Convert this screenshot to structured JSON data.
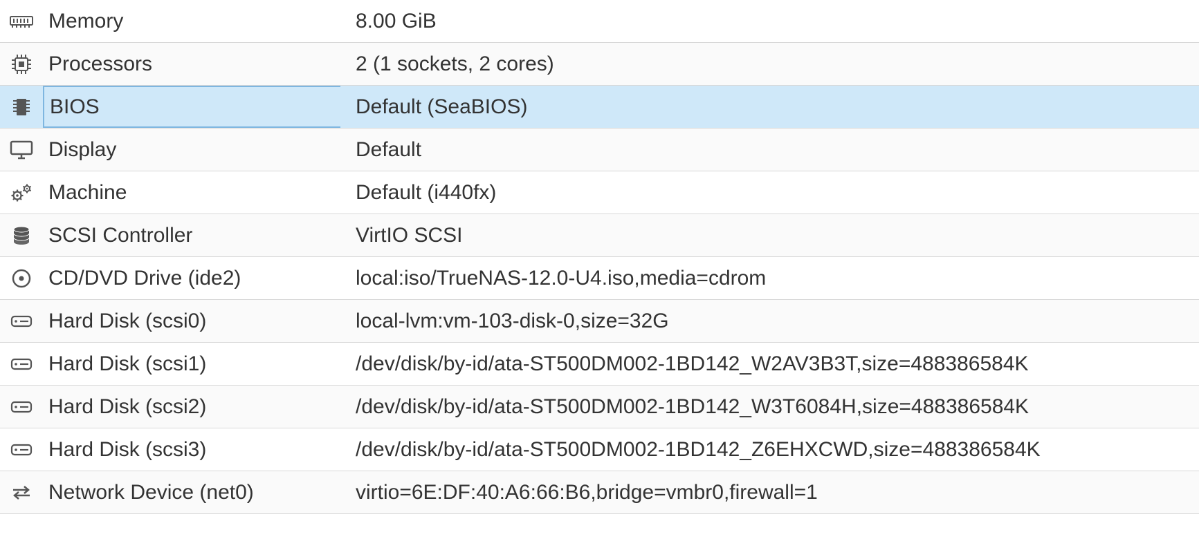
{
  "hardware": {
    "selectedIndex": 2,
    "rows": [
      {
        "icon": "memory-icon",
        "label": "Memory",
        "value": "8.00 GiB"
      },
      {
        "icon": "cpu-icon",
        "label": "Processors",
        "value": "2 (1 sockets, 2 cores)"
      },
      {
        "icon": "bios-chip-icon",
        "label": "BIOS",
        "value": "Default (SeaBIOS)"
      },
      {
        "icon": "display-icon",
        "label": "Display",
        "value": "Default"
      },
      {
        "icon": "gears-icon",
        "label": "Machine",
        "value": "Default (i440fx)"
      },
      {
        "icon": "database-icon",
        "label": "SCSI Controller",
        "value": "VirtIO SCSI"
      },
      {
        "icon": "disc-icon",
        "label": "CD/DVD Drive (ide2)",
        "value": "local:iso/TrueNAS-12.0-U4.iso,media=cdrom"
      },
      {
        "icon": "hdd-icon",
        "label": "Hard Disk (scsi0)",
        "value": "local-lvm:vm-103-disk-0,size=32G"
      },
      {
        "icon": "hdd-icon",
        "label": "Hard Disk (scsi1)",
        "value": "/dev/disk/by-id/ata-ST500DM002-1BD142_W2AV3B3T,size=488386584K"
      },
      {
        "icon": "hdd-icon",
        "label": "Hard Disk (scsi2)",
        "value": "/dev/disk/by-id/ata-ST500DM002-1BD142_W3T6084H,size=488386584K"
      },
      {
        "icon": "hdd-icon",
        "label": "Hard Disk (scsi3)",
        "value": "/dev/disk/by-id/ata-ST500DM002-1BD142_Z6EHXCWD,size=488386584K"
      },
      {
        "icon": "network-icon",
        "label": "Network Device (net0)",
        "value": "virtio=6E:DF:40:A6:66:B6,bridge=vmbr0,firewall=1"
      }
    ]
  }
}
